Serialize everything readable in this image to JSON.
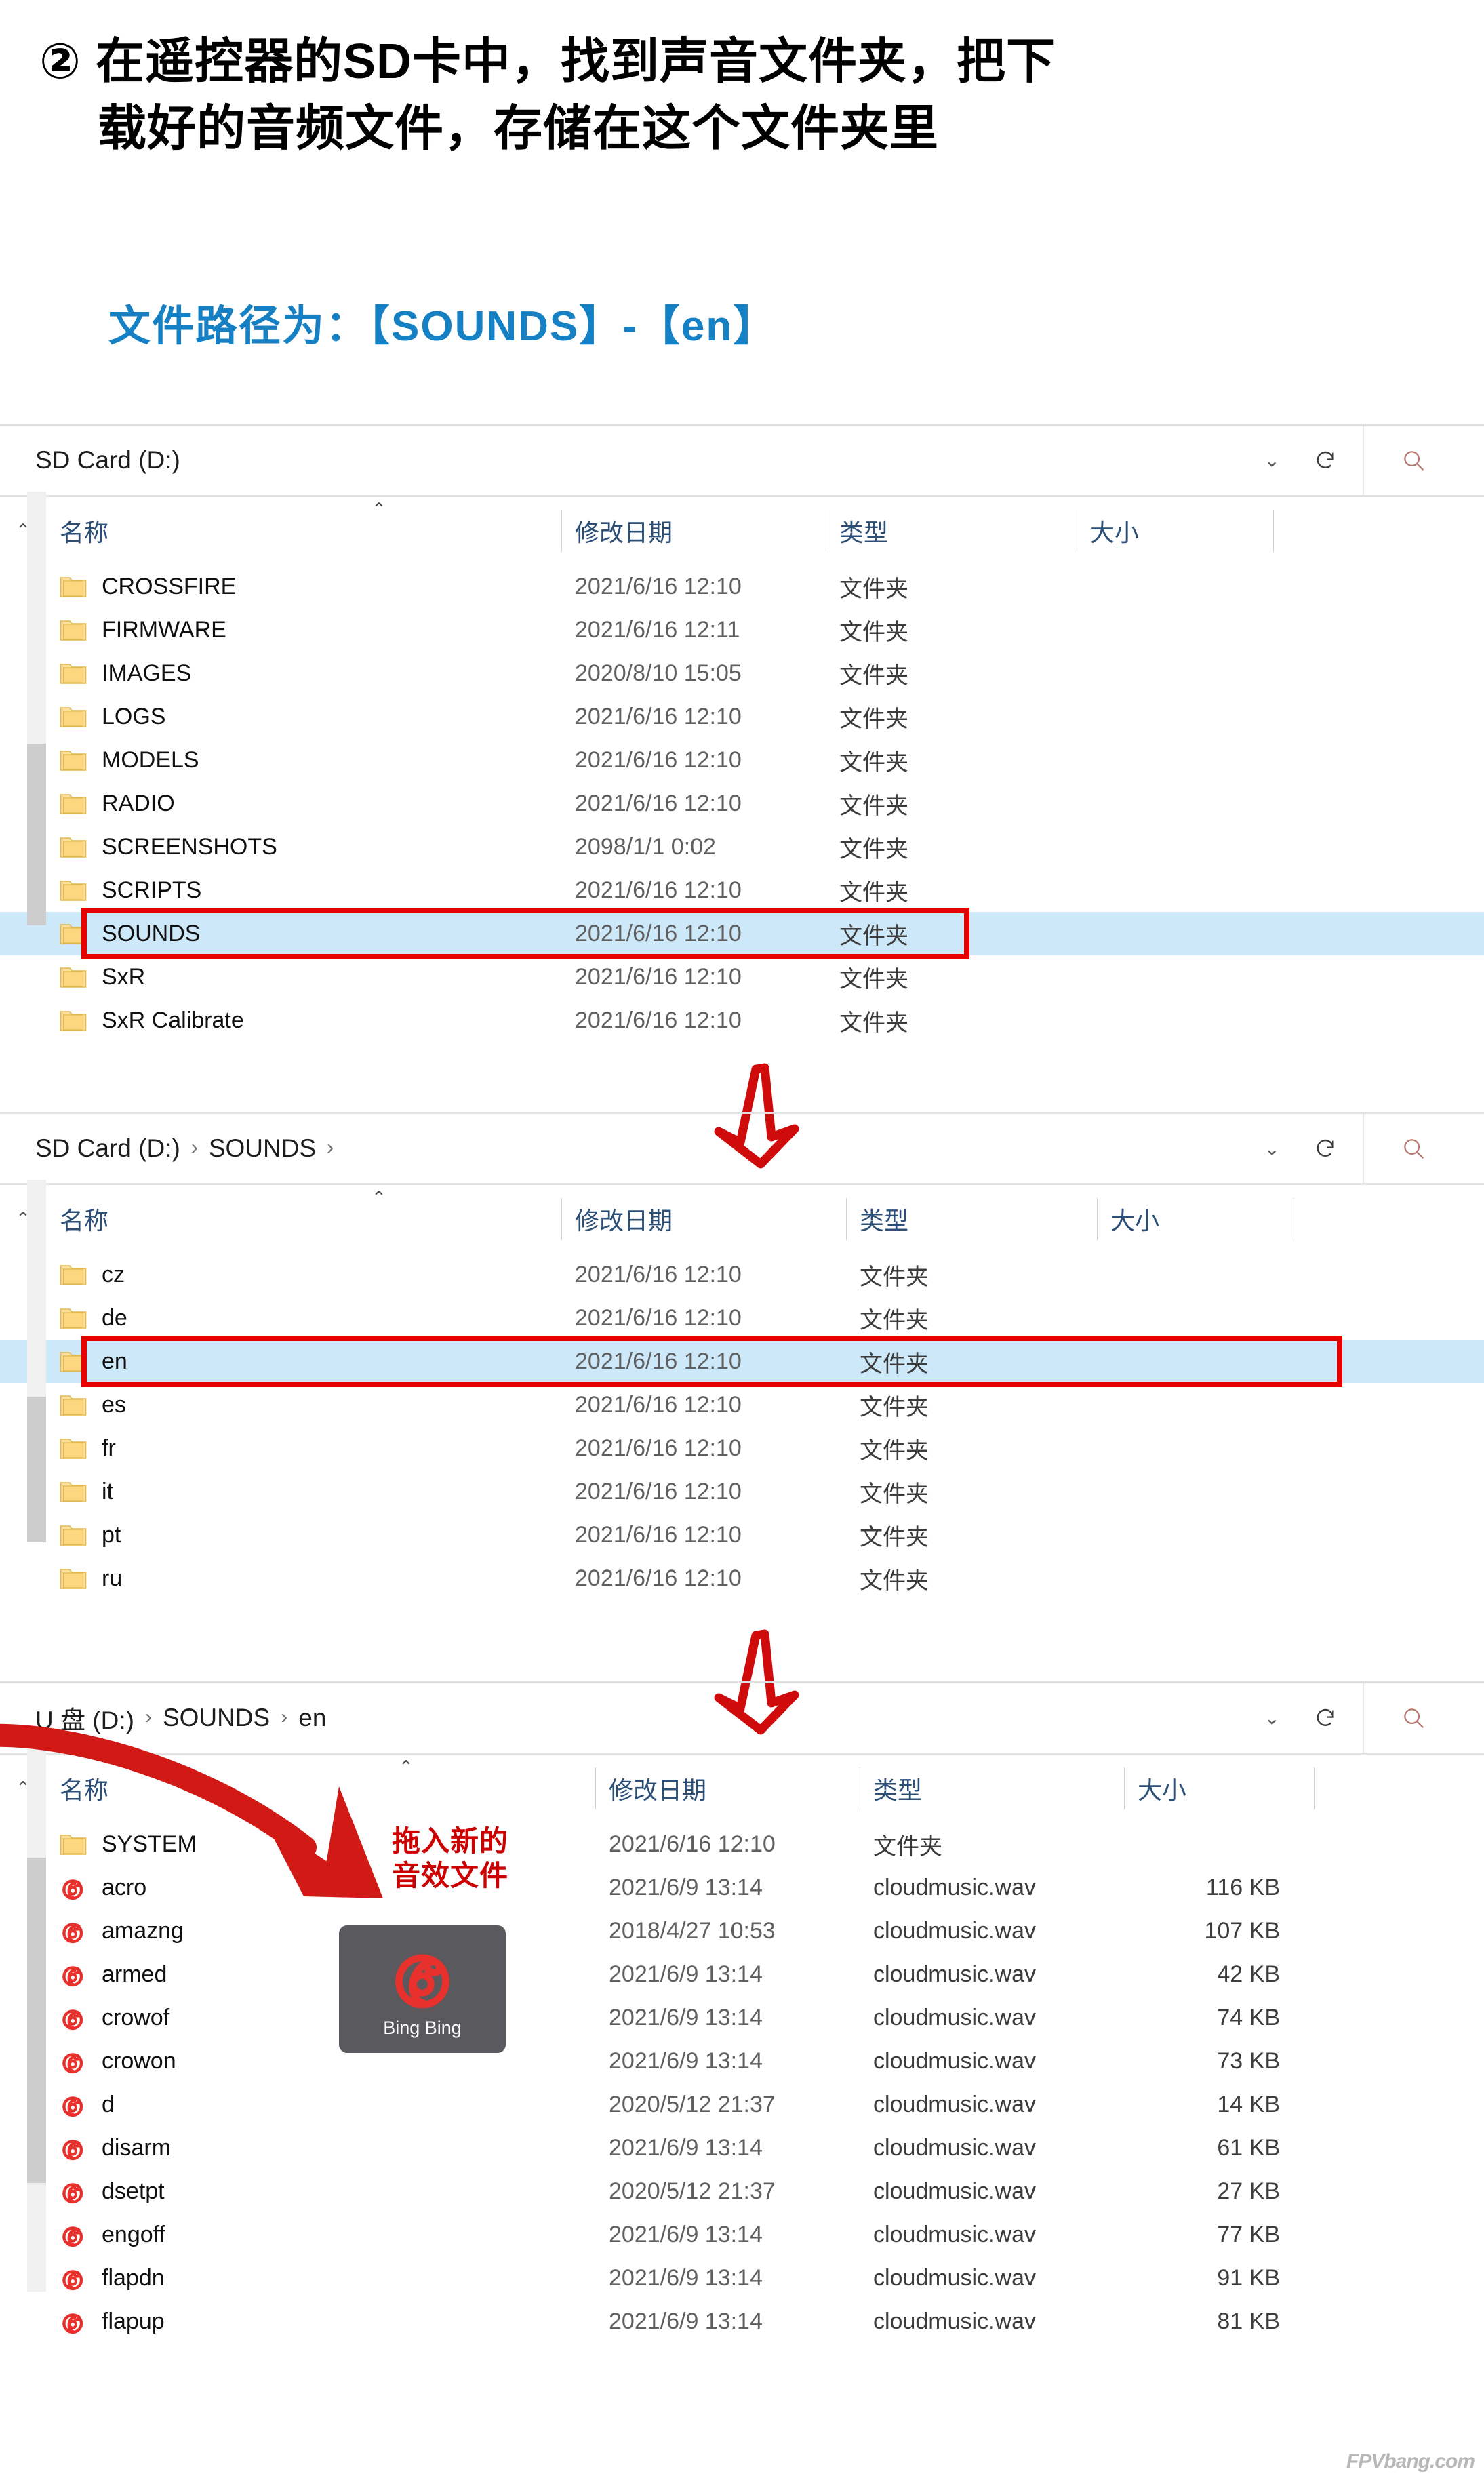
{
  "heading": {
    "marker": "②",
    "line1": "在遥控器的SD卡中，找到声音文件夹，把下",
    "line2": "载好的音频文件，存储在这个文件夹里"
  },
  "subheading": "文件路径为：【SOUNDS】-【en】",
  "columns": {
    "name": "名称",
    "date": "修改日期",
    "type": "类型",
    "size": "大小"
  },
  "explorer1": {
    "address": "SD Card (D:)",
    "breadcrumbs": [
      "SD Card (D:)"
    ],
    "rows": [
      {
        "name": "CROSSFIRE",
        "icon": "folder-icon",
        "date": "2021/6/16 12:10",
        "type": "文件夹",
        "size": ""
      },
      {
        "name": "FIRMWARE",
        "icon": "folder-icon",
        "date": "2021/6/16 12:11",
        "type": "文件夹",
        "size": ""
      },
      {
        "name": "IMAGES",
        "icon": "folder-icon",
        "date": "2020/8/10 15:05",
        "type": "文件夹",
        "size": ""
      },
      {
        "name": "LOGS",
        "icon": "folder-icon",
        "date": "2021/6/16 12:10",
        "type": "文件夹",
        "size": ""
      },
      {
        "name": "MODELS",
        "icon": "folder-icon",
        "date": "2021/6/16 12:10",
        "type": "文件夹",
        "size": ""
      },
      {
        "name": "RADIO",
        "icon": "folder-icon",
        "date": "2021/6/16 12:10",
        "type": "文件夹",
        "size": ""
      },
      {
        "name": "SCREENSHOTS",
        "icon": "folder-icon",
        "date": "2098/1/1 0:02",
        "type": "文件夹",
        "size": ""
      },
      {
        "name": "SCRIPTS",
        "icon": "folder-icon",
        "date": "2021/6/16 12:10",
        "type": "文件夹",
        "size": ""
      },
      {
        "name": "SOUNDS",
        "icon": "folder-icon",
        "date": "2021/6/16 12:10",
        "type": "文件夹",
        "size": "",
        "selected": true
      },
      {
        "name": "SxR",
        "icon": "folder-icon",
        "date": "2021/6/16 12:10",
        "type": "文件夹",
        "size": ""
      },
      {
        "name": "SxR Calibrate",
        "icon": "folder-icon",
        "date": "2021/6/16 12:10",
        "type": "文件夹",
        "size": ""
      }
    ]
  },
  "explorer2": {
    "address": "SD Card (D:) › SOUNDS ›",
    "breadcrumbs": [
      "SD Card (D:)",
      "SOUNDS"
    ],
    "rows": [
      {
        "name": "cz",
        "icon": "folder-icon",
        "date": "2021/6/16 12:10",
        "type": "文件夹",
        "size": ""
      },
      {
        "name": "de",
        "icon": "folder-icon",
        "date": "2021/6/16 12:10",
        "type": "文件夹",
        "size": ""
      },
      {
        "name": "en",
        "icon": "folder-icon",
        "date": "2021/6/16 12:10",
        "type": "文件夹",
        "size": "",
        "selected": true
      },
      {
        "name": "es",
        "icon": "folder-icon",
        "date": "2021/6/16 12:10",
        "type": "文件夹",
        "size": ""
      },
      {
        "name": "fr",
        "icon": "folder-icon",
        "date": "2021/6/16 12:10",
        "type": "文件夹",
        "size": ""
      },
      {
        "name": "it",
        "icon": "folder-icon",
        "date": "2021/6/16 12:10",
        "type": "文件夹",
        "size": ""
      },
      {
        "name": "pt",
        "icon": "folder-icon",
        "date": "2021/6/16 12:10",
        "type": "文件夹",
        "size": ""
      },
      {
        "name": "ru",
        "icon": "folder-icon",
        "date": "2021/6/16 12:10",
        "type": "文件夹",
        "size": ""
      }
    ]
  },
  "explorer3": {
    "address": "U 盘 (D:) › SOUNDS › en",
    "breadcrumbs": [
      "U 盘 (D:)",
      "SOUNDS",
      "en"
    ],
    "rows": [
      {
        "name": "SYSTEM",
        "icon": "folder-icon",
        "date": "2021/6/16 12:10",
        "type": "文件夹",
        "size": ""
      },
      {
        "name": "acro",
        "icon": "cloudmusic-icon",
        "date": "2021/6/9 13:14",
        "type": "cloudmusic.wav",
        "size": "116 KB"
      },
      {
        "name": "amazng",
        "icon": "cloudmusic-icon",
        "date": "2018/4/27 10:53",
        "type": "cloudmusic.wav",
        "size": "107 KB"
      },
      {
        "name": "armed",
        "icon": "cloudmusic-icon",
        "date": "2021/6/9 13:14",
        "type": "cloudmusic.wav",
        "size": "42 KB"
      },
      {
        "name": "crowof",
        "icon": "cloudmusic-icon",
        "date": "2021/6/9 13:14",
        "type": "cloudmusic.wav",
        "size": "74 KB"
      },
      {
        "name": "crowon",
        "icon": "cloudmusic-icon",
        "date": "2021/6/9 13:14",
        "type": "cloudmusic.wav",
        "size": "73 KB"
      },
      {
        "name": "d",
        "icon": "cloudmusic-icon",
        "date": "2020/5/12 21:37",
        "type": "cloudmusic.wav",
        "size": "14 KB"
      },
      {
        "name": "disarm",
        "icon": "cloudmusic-icon",
        "date": "2021/6/9 13:14",
        "type": "cloudmusic.wav",
        "size": "61 KB"
      },
      {
        "name": "dsetpt",
        "icon": "cloudmusic-icon",
        "date": "2020/5/12 21:37",
        "type": "cloudmusic.wav",
        "size": "27 KB"
      },
      {
        "name": "engoff",
        "icon": "cloudmusic-icon",
        "date": "2021/6/9 13:14",
        "type": "cloudmusic.wav",
        "size": "77 KB"
      },
      {
        "name": "flapdn",
        "icon": "cloudmusic-icon",
        "date": "2021/6/9 13:14",
        "type": "cloudmusic.wav",
        "size": "91 KB"
      },
      {
        "name": "flapup",
        "icon": "cloudmusic-icon",
        "date": "2021/6/9 13:14",
        "type": "cloudmusic.wav",
        "size": "81 KB"
      }
    ],
    "annotation": {
      "line1": "拖入新的",
      "line2": "音效文件"
    },
    "thumbnail": {
      "label": "Bing Bing",
      "icon": "netease-cloudmusic-icon"
    }
  },
  "watermark": "FPVbang.com",
  "colors": {
    "accent_blue": "#1581c4",
    "highlight_red": "#e60000",
    "selection_blue": "#cde8f9",
    "folder_yellow": "#f7d277",
    "cloudmusic_red": "#e8302c",
    "annotation_red": "#cc0000"
  }
}
